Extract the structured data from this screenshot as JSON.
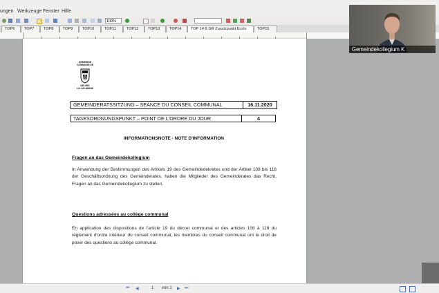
{
  "menu": {
    "items": [
      "ungen",
      "Werkzeuge",
      "Fenster",
      "Hilfe"
    ]
  },
  "toolbar": {
    "zoom": "100%"
  },
  "tabs": [
    "TOP6",
    "TOP7",
    "TOP8",
    "TOP9",
    "TOP10",
    "TOP11",
    "TOP12",
    "TOP13",
    "TOP14",
    "TOP 14 B GR Zusatzpunkt Ecolo",
    "TOP15"
  ],
  "logo": {
    "top_text": "GEMEINDE\nCOMMUNE DE",
    "bottom_text": "KELMIS\nLA CALAMINE"
  },
  "document": {
    "header_row1_label": "GEMEINDERATSSITZUNG – SEANCE DU CONSEIL COMMUNAL",
    "header_row1_value": "16.11.2020",
    "header_row2_label": "TAGESORDNUNGSPUNKT – POINT DE L'ORDRE DU JOUR",
    "header_row2_value": "4",
    "title": "INFORMATIONSNOTE - NOTE D'INFORMATION",
    "section1_title": "Fragen an das Gemeindekollegium",
    "section1_body": "In Anwendung der Bestimmungen des Artikels 19 des Gemeindedekretes und der Artikel 108 bis 116 der Geschäftsordnung des Gemeinderates, haben die Mitglieder des Gemeinderates das Recht, Fragen an das Gemeindekollegium zu stellen.",
    "section2_title": "Questions adressées au collège communal",
    "section2_body": "En application des dispositions de l'article 19 du décret communal et des articles 108 à 116 du règlement d'ordre intérieur du conseil communal, les membres du conseil communal ont le droit de poser des questions au collège communal."
  },
  "status": {
    "page_number": "1",
    "page_of": "von 1"
  },
  "video": {
    "label": "Gemeindekollegium K"
  },
  "colors": {
    "accent": "#4d6fa8",
    "page_bg": "#aeb0b2"
  }
}
